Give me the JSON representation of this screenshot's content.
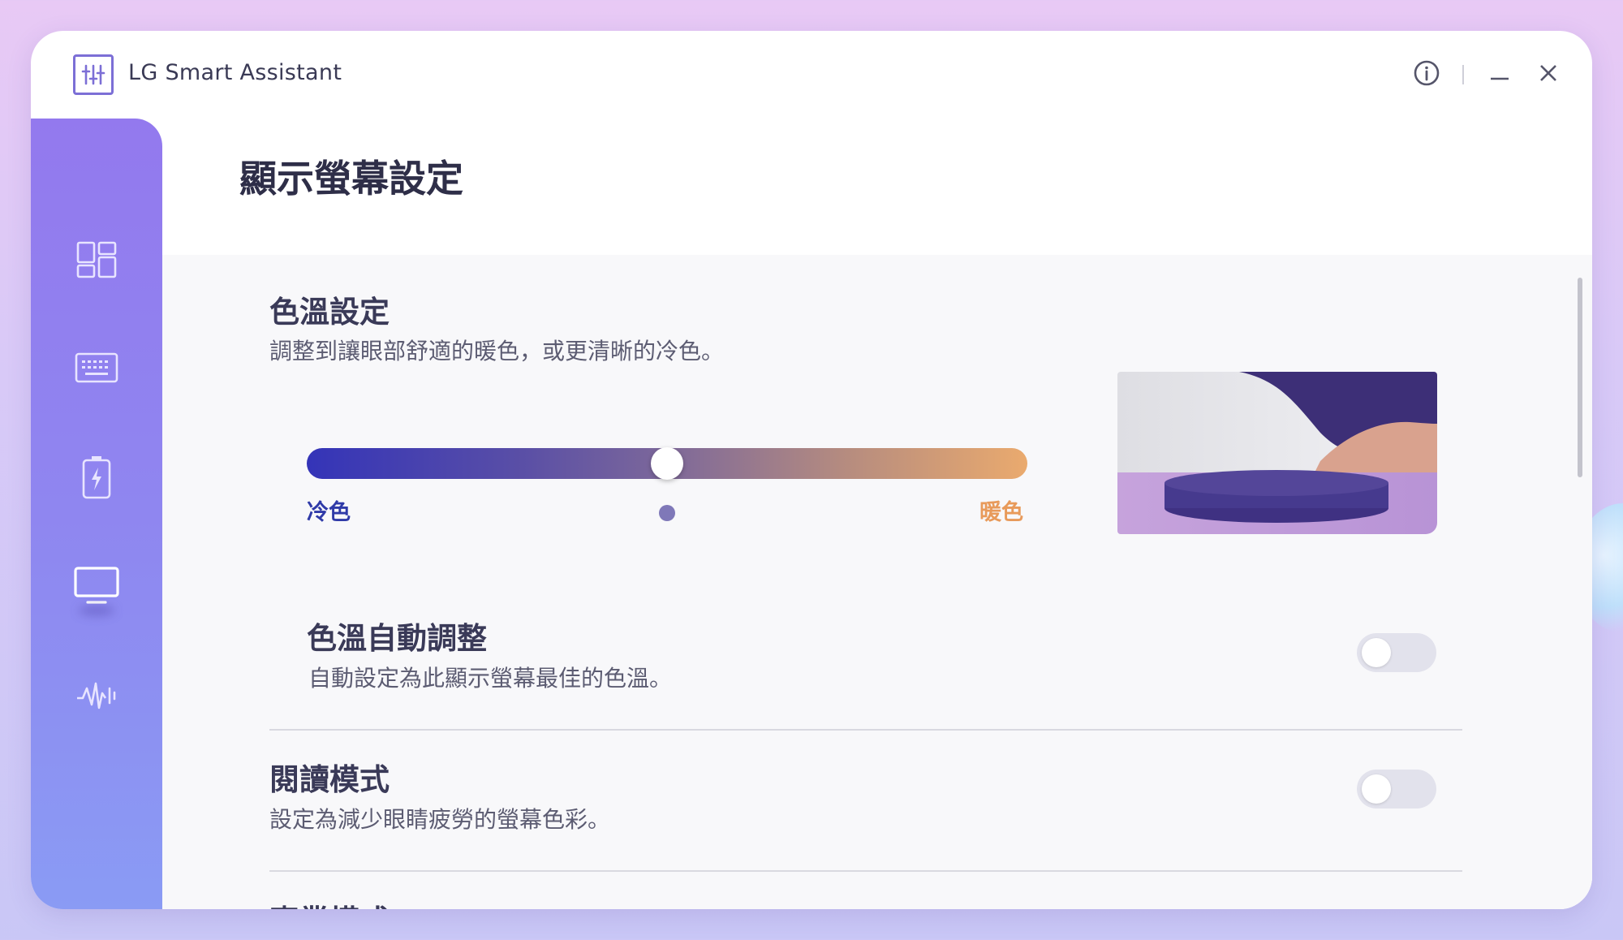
{
  "app": {
    "title": "LG Smart Assistant"
  },
  "titlebar": {
    "icons": [
      "info-icon",
      "minimize-icon",
      "close-icon"
    ]
  },
  "sidebar": {
    "items": [
      {
        "id": "dashboard",
        "icon": "dashboard-grid-icon",
        "active": false
      },
      {
        "id": "keyboard",
        "icon": "keyboard-icon",
        "active": false
      },
      {
        "id": "battery",
        "icon": "battery-charging-icon",
        "active": false
      },
      {
        "id": "display",
        "icon": "monitor-icon",
        "active": true
      },
      {
        "id": "audio",
        "icon": "audio-wave-icon",
        "active": false
      }
    ]
  },
  "page": {
    "title": "顯示螢幕設定"
  },
  "color_temp": {
    "title": "色溫設定",
    "description": "調整到讓眼部舒適的暖色，或更清晰的冷色。",
    "cool_label": "冷色",
    "warm_label": "暖色",
    "value_fraction": 0.5,
    "default_fraction": 0.5,
    "colors": {
      "cool": "#3434b8",
      "warm": "#eaaa6e"
    }
  },
  "auto_adjust": {
    "title": "色溫自動調整",
    "description": "自動設定為此顯示螢幕最佳的色溫。",
    "enabled": false
  },
  "reading_mode": {
    "title": "閱讀模式",
    "description": "設定為減少眼睛疲勞的螢幕色彩。",
    "enabled": false
  },
  "pro_mode": {
    "title": "專業模式"
  },
  "colors": {
    "accent": "#8f86f0",
    "title_text": "#2e2e48"
  }
}
